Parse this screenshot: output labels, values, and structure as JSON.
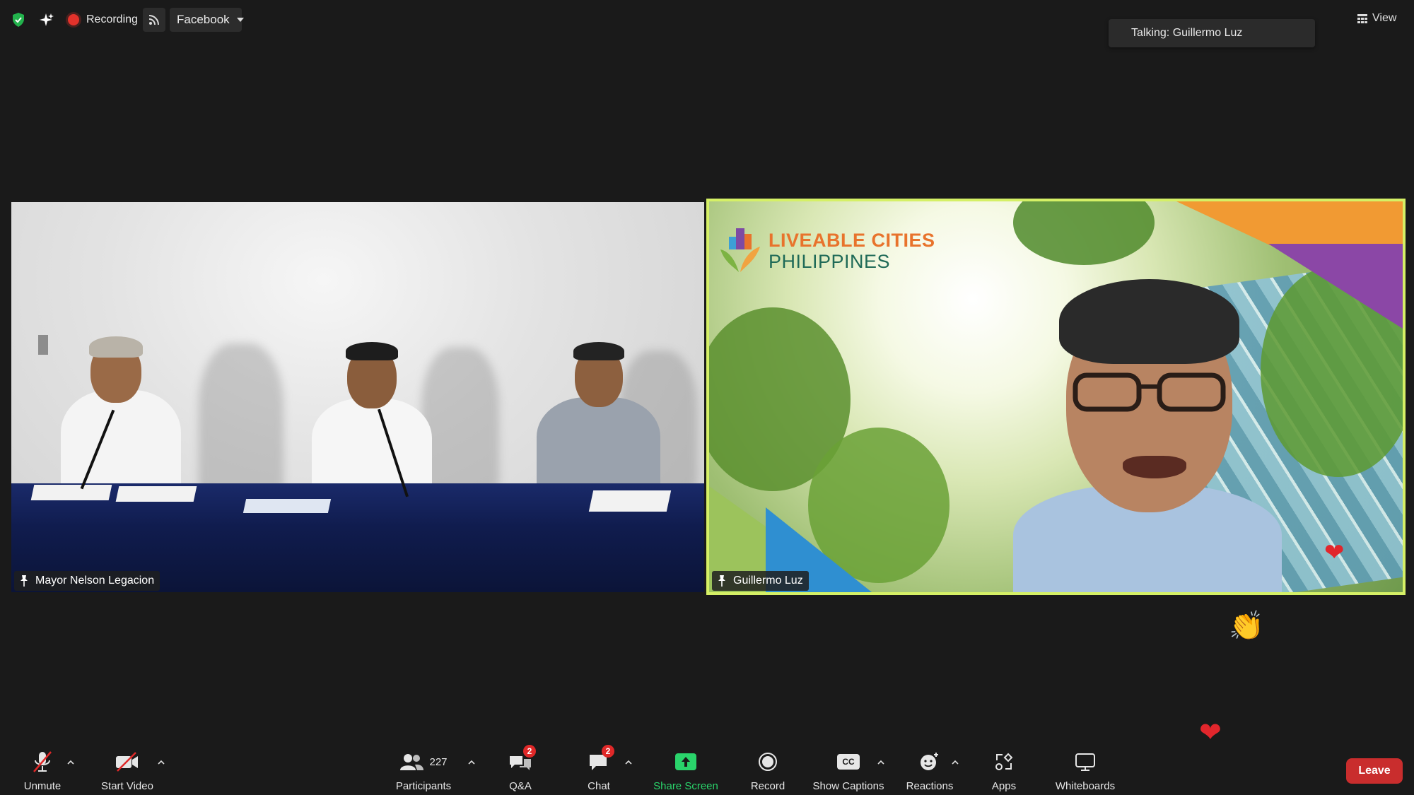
{
  "top_bar": {
    "recording_label": "Recording",
    "stream_target": "Facebook",
    "talking_indicator": "Talking: Guillermo Luz",
    "view_label": "View"
  },
  "tiles": [
    {
      "name": "Mayor Nelson Legacion"
    },
    {
      "name": "Guillermo Luz",
      "active_speaker": true,
      "logo_line1": "LIVEABLE CITIES",
      "logo_line2": "PHILIPPINES"
    }
  ],
  "toolbar": {
    "unmute": "Unmute",
    "start_video": "Start Video",
    "participants": "Participants",
    "participants_count": "227",
    "qa": "Q&A",
    "qa_badge": "2",
    "chat": "Chat",
    "chat_badge": "2",
    "share_screen": "Share Screen",
    "record": "Record",
    "show_captions": "Show Captions",
    "captions_icon_text": "CC",
    "reactions": "Reactions",
    "apps": "Apps",
    "whiteboards": "Whiteboards",
    "leave": "Leave"
  },
  "colors": {
    "background": "#1a1a1a",
    "active_speaker_border": "#d5f066",
    "share_green": "#2ad46b",
    "leave_red": "#c92d2d",
    "badge_red": "#e02828"
  },
  "floating_reactions": [
    "clap-emoji",
    "heart-emoji"
  ]
}
